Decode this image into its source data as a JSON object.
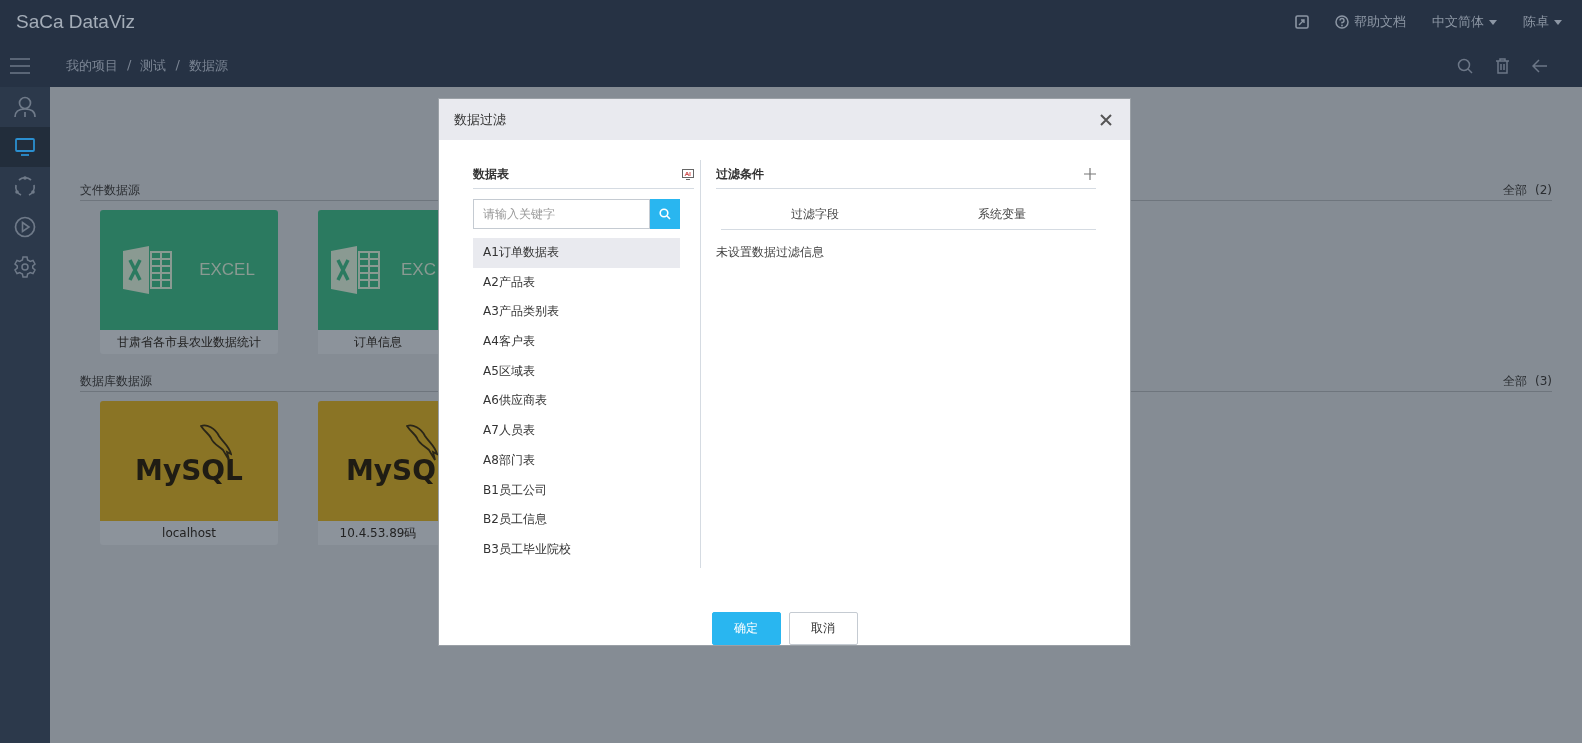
{
  "header": {
    "logo": "SaCa DataViz",
    "help": "帮助文档",
    "language": "中文简体",
    "user": "陈卓"
  },
  "breadcrumb": [
    {
      "label": "我的项目"
    },
    {
      "separator": "/",
      "label": "测试"
    },
    {
      "separator": "/",
      "label": "数据源"
    }
  ],
  "sidebar": {
    "items": [
      {
        "kind": "user",
        "selected": false
      },
      {
        "kind": "monitor",
        "selected": true
      },
      {
        "kind": "cycle",
        "selected": false
      },
      {
        "kind": "play",
        "selected": false
      },
      {
        "kind": "gear",
        "selected": false
      }
    ]
  },
  "sections": [
    {
      "title": "文件数据源",
      "summary": "全部",
      "count": "(2)",
      "cards": [
        {
          "kind": "excel",
          "logo": "EXCEL",
          "label": "甘肃省各市县农业数据统计"
        },
        {
          "kind": "excel",
          "logo": "EXC",
          "label": "订单信息"
        }
      ]
    },
    {
      "title": "数据库数据源",
      "summary": "全部",
      "count": "(3)",
      "cards": [
        {
          "kind": "mysql",
          "logo": "MySQL",
          "label": "localhost"
        },
        {
          "kind": "mysql",
          "logo": "MySQ",
          "label": "10.4.53.89码"
        }
      ]
    }
  ],
  "dialog": {
    "title": "数据过滤",
    "tables_title": "数据表",
    "search": {
      "placeholder": "请输入关键字"
    },
    "tables": [
      {
        "label": "A1订单数据表",
        "selected": true
      },
      {
        "label": "A2产品表",
        "selected": false
      },
      {
        "label": "A3产品类别表",
        "selected": false
      },
      {
        "label": "A4客户表",
        "selected": false
      },
      {
        "label": "A5区域表",
        "selected": false
      },
      {
        "label": "A6供应商表",
        "selected": false
      },
      {
        "label": "A7人员表",
        "selected": false
      },
      {
        "label": "A8部门表",
        "selected": false
      },
      {
        "label": "B1员工公司",
        "selected": false
      },
      {
        "label": "B2员工信息",
        "selected": false
      },
      {
        "label": "B3员工毕业院校",
        "selected": false
      }
    ],
    "filter_title": "过滤条件",
    "columns": [
      "过滤字段",
      "系统变量"
    ],
    "empty": "未设置数据过滤信息",
    "buttons": [
      {
        "kind": "primary",
        "label": "确定"
      },
      {
        "kind": "default",
        "label": "取消"
      }
    ]
  }
}
